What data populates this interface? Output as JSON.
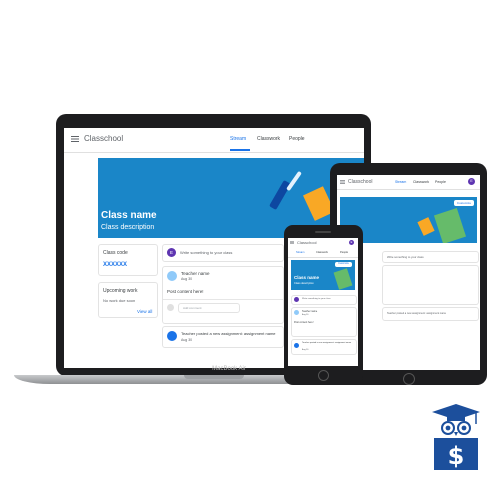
{
  "laptop": {
    "app_title": "Classchool",
    "tabs": [
      "Stream",
      "Classwork",
      "People"
    ],
    "avatar_letter": "E",
    "class_name": "Class name",
    "class_description": "Class description",
    "class_code_label": "Class code",
    "class_code_value": "XXXXXX",
    "upcoming_label": "Upcoming work",
    "upcoming_text": "No work due soon",
    "view_all": "View all",
    "share_placeholder": "Write something to your class",
    "teacher_name": "Teacher name",
    "post_date": "Aug 30",
    "post_text": "Post content here!",
    "comment_placeholder": "Add comment",
    "assignment_text": "Teacher posted a new assignment: assignment name",
    "assignment_date": "Aug 30",
    "brand_label": "MacBook Air"
  },
  "tablet": {
    "app_title": "Classchool",
    "tabs": [
      "Stream",
      "Classwork",
      "People"
    ],
    "avatar_letter": "E",
    "customize": "Customize",
    "share_placeholder": "Write something to your class",
    "assignment_text": "Teacher posted a new assignment: assignment name"
  },
  "phone": {
    "app_title": "Classchool",
    "tabs": [
      "Stream",
      "Classwork",
      "People"
    ],
    "avatar_letter": "E",
    "customize": "Customize",
    "class_name": "Class name",
    "class_description": "Class description",
    "share_placeholder": "Write something to your class",
    "teacher_name": "Teacher name",
    "post_date": "Aug 30",
    "post_text": "Post content here!",
    "assignment_text": "Teacher posted a new assignment: assignment name",
    "assignment_date": "Aug 30"
  },
  "colors": {
    "accent": "#1a73e8",
    "banner": "#1a86c8",
    "avatar": "#5e35b1",
    "logo": "#1c4f9c"
  }
}
